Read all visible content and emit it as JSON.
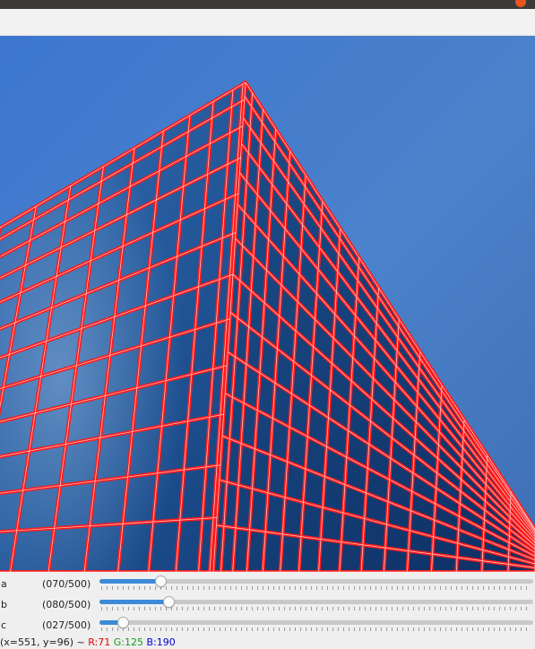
{
  "window": {
    "title": ""
  },
  "trackbars": [
    {
      "label": "a",
      "value_text": "(070/500)",
      "value": 70,
      "max": 500
    },
    {
      "label": "b",
      "value_text": "(080/500)",
      "value": 80,
      "max": 500
    },
    {
      "label": "c",
      "value_text": "(027/500)",
      "value": 27,
      "max": 500
    }
  ],
  "status": {
    "coords": "(x=551, y=96) ~",
    "r": "R:71",
    "g": "G:125",
    "b": "B:190"
  },
  "colors": {
    "edge_overlay": "#ff0000",
    "sky": "#4a7fc8",
    "slider_accent": "#3c8ad8",
    "status_r": "#e00000",
    "status_g": "#1a9a1a",
    "status_b": "#0000d0"
  }
}
